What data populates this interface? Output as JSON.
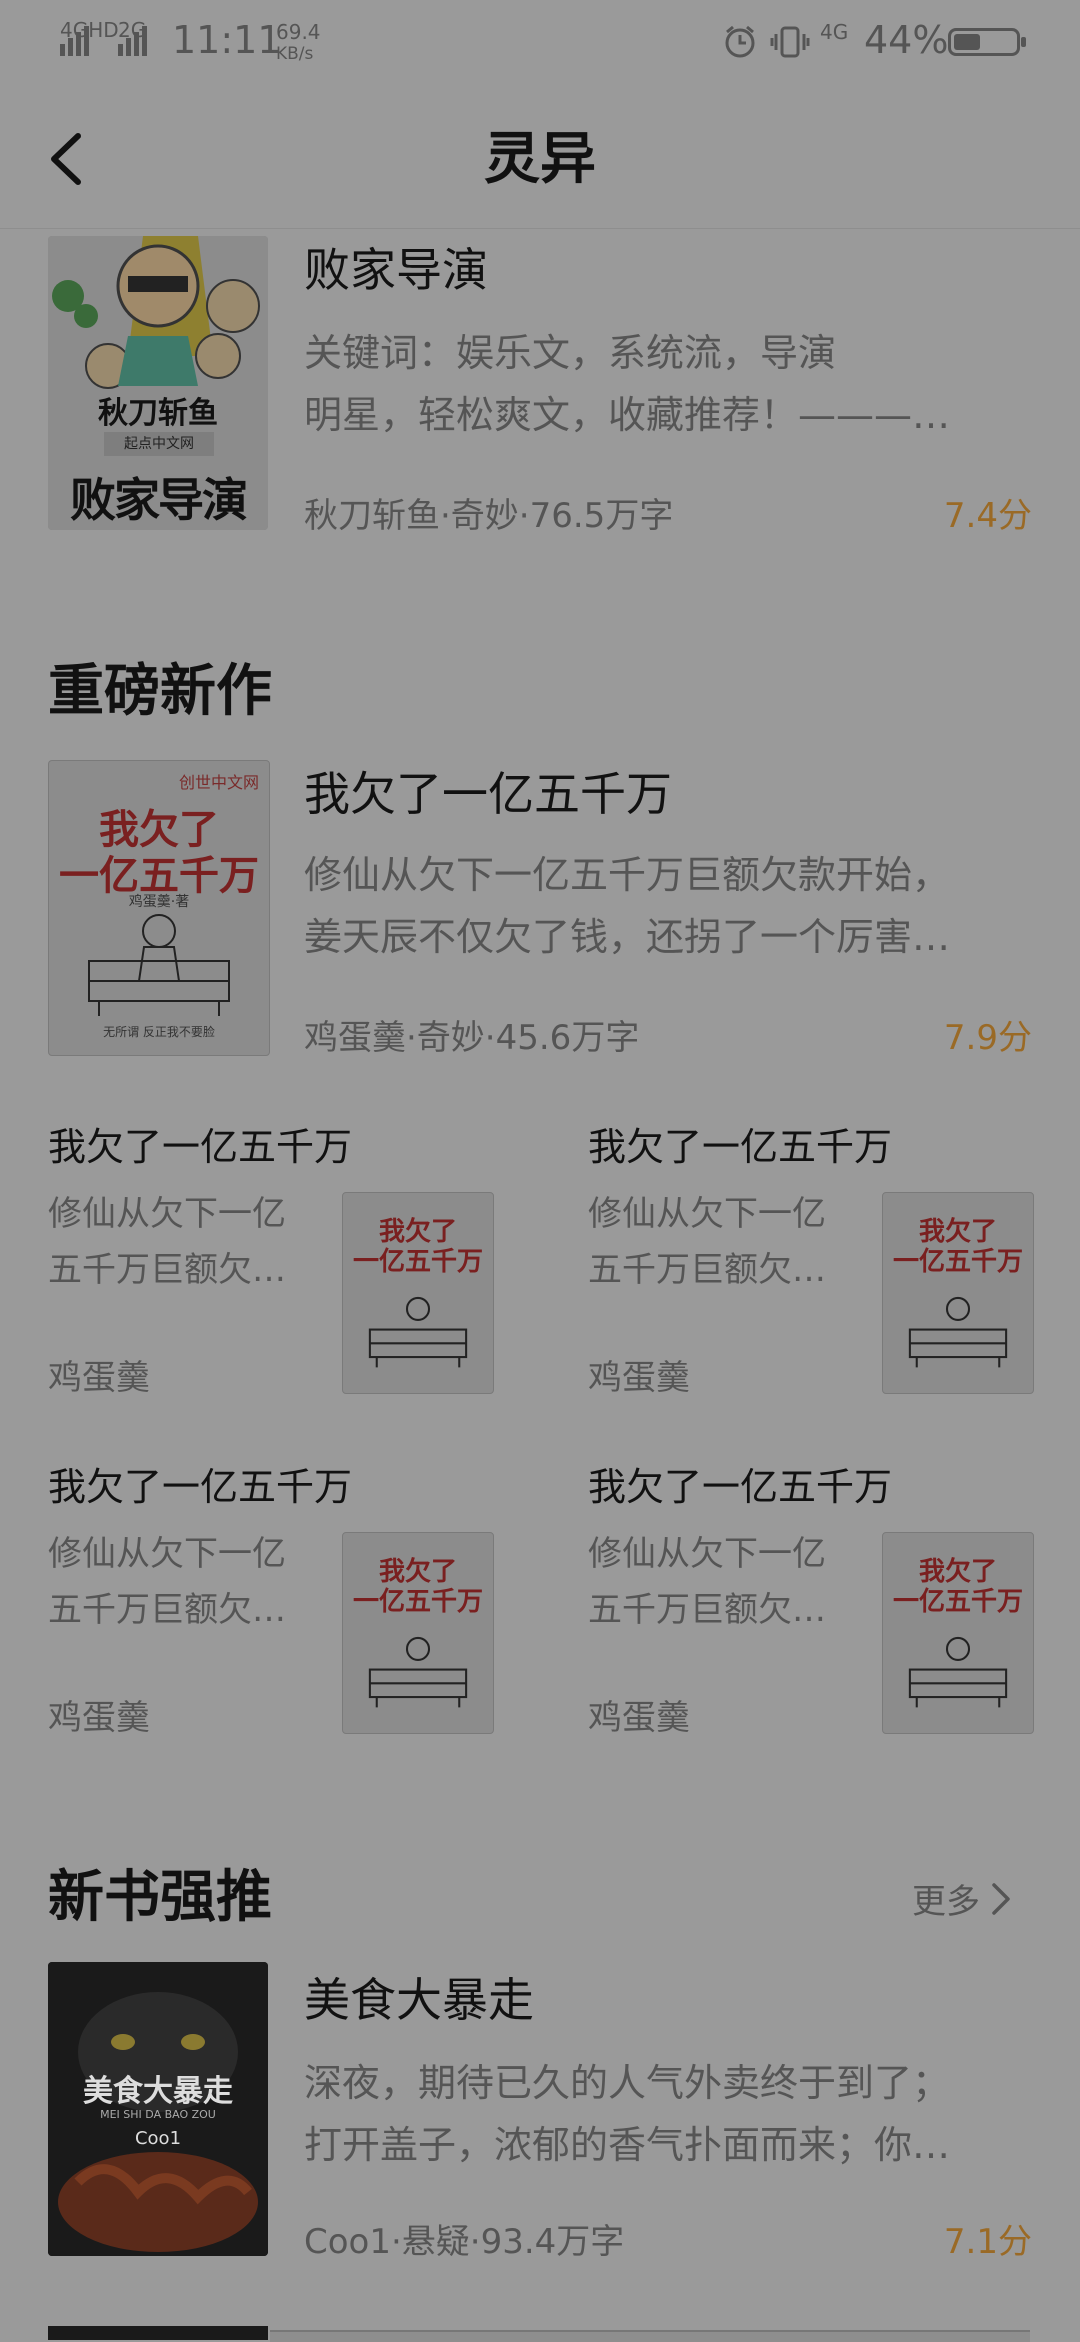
{
  "status_bar": {
    "network_left": "4GHD",
    "network_mid": "2G",
    "time": "11:11",
    "speed_value": "69.4",
    "speed_unit": "KB/s",
    "network_right": "4G",
    "battery_percent": "44%",
    "battery_level": 0.44,
    "icons": [
      "alarm-icon",
      "vibrate-icon",
      "signal-icon",
      "battery-icon"
    ]
  },
  "header": {
    "title": "灵异",
    "back_icon": "back-chevron-icon"
  },
  "top_book": {
    "name": "败家导演",
    "desc_line1": "关键词：娱乐文，系统流，导演",
    "desc_line2": "明星，轻松爽文，收藏推荐！———…",
    "meta": "秋刀斩鱼·奇妙·76.5万字",
    "score": "7.4分",
    "cover_author": "秋刀斩鱼",
    "cover_publisher": "起点中文网",
    "cover_title": "败家导演"
  },
  "section_heavy": {
    "title": "重磅新作",
    "featured": {
      "name": "我欠了一亿五千万",
      "desc_line1": "修仙从欠下一亿五千万巨额欠款开始，",
      "desc_line2": "姜天辰不仅欠了钱，还拐了一个厉害…",
      "meta": "鸡蛋羹·奇妙·45.6万字",
      "score": "7.9分"
    },
    "cover": {
      "brand": "创世中文网",
      "title_line1": "我欠了",
      "title_line2": "一亿五千万",
      "author": "鸡蛋羹·著",
      "slogan": "无所谓 反正我不要脸"
    },
    "grid": [
      {
        "name": "我欠了一亿五千万",
        "desc_line1": "修仙从欠下一亿",
        "desc_line2": "五千万巨额欠…",
        "author": "鸡蛋羹"
      },
      {
        "name": "我欠了一亿五千万",
        "desc_line1": "修仙从欠下一亿",
        "desc_line2": "五千万巨额欠…",
        "author": "鸡蛋羹"
      },
      {
        "name": "我欠了一亿五千万",
        "desc_line1": "修仙从欠下一亿",
        "desc_line2": "五千万巨额欠…",
        "author": "鸡蛋羹"
      },
      {
        "name": "我欠了一亿五千万",
        "desc_line1": "修仙从欠下一亿",
        "desc_line2": "五千万巨额欠…",
        "author": "鸡蛋羹"
      }
    ]
  },
  "section_new": {
    "title": "新书强推",
    "more": "更多",
    "book": {
      "name": "美食大暴走",
      "desc_line1": "深夜，期待已久的人气外卖终于到了；",
      "desc_line2": "打开盖子，浓郁的香气扑面而来；你…",
      "meta": "Coo1·悬疑·93.4万字",
      "score": "7.1分",
      "cover_title": "美食大暴走",
      "cover_pinyin": "MEI SHI DA BAO ZOU",
      "cover_author": "Coo1"
    }
  }
}
